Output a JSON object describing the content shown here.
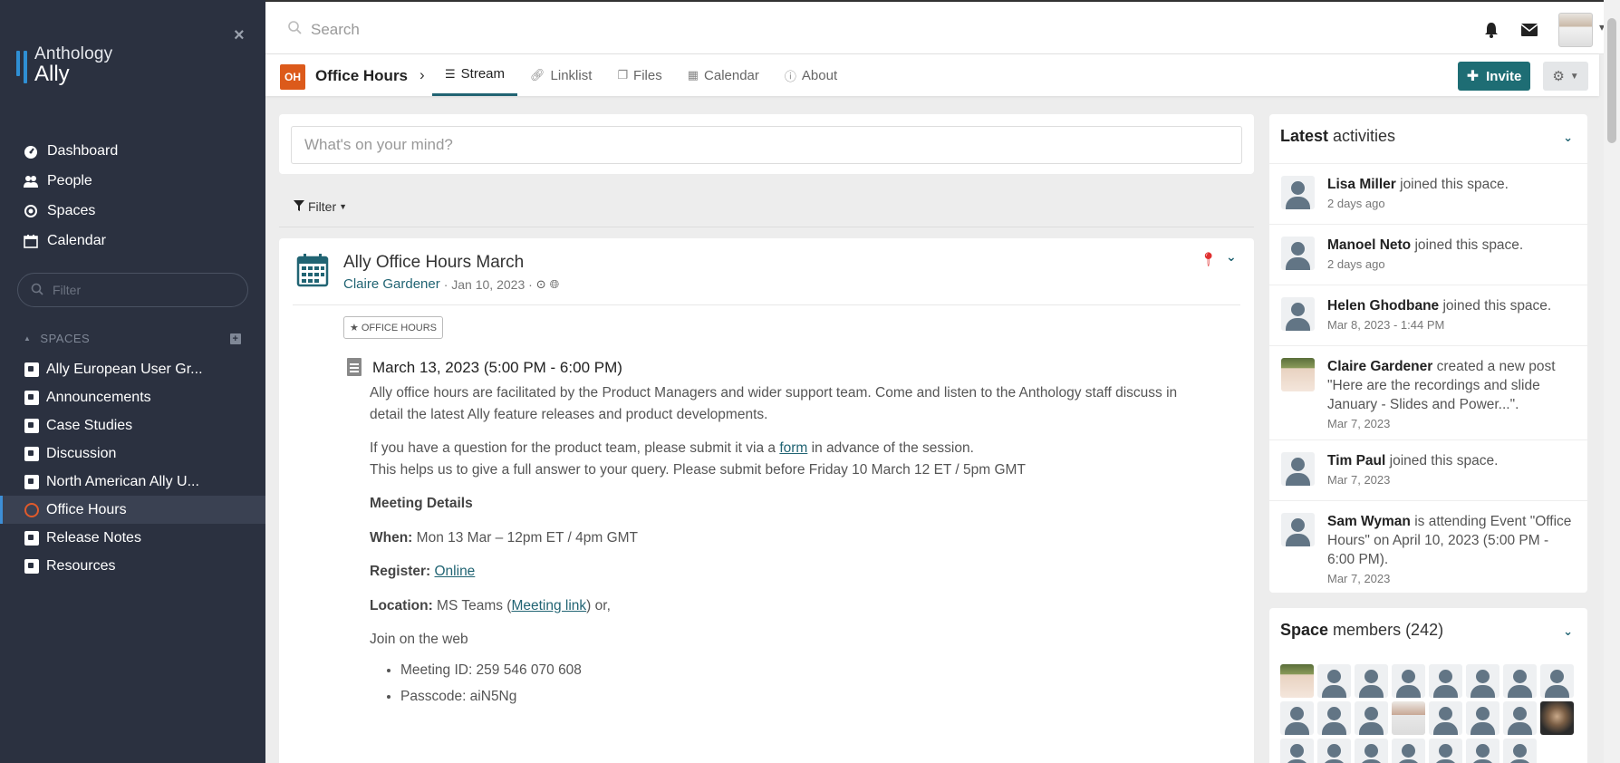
{
  "sidebar": {
    "logo_line1": "Anthology",
    "logo_line2": "Ally",
    "nav": [
      {
        "label": "Dashboard",
        "icon": "dashboard-icon"
      },
      {
        "label": "People",
        "icon": "people-icon"
      },
      {
        "label": "Spaces",
        "icon": "spaces-icon"
      },
      {
        "label": "Calendar",
        "icon": "calendar-icon"
      }
    ],
    "filter_placeholder": "Filter",
    "spaces_header": "SPACES",
    "spaces": [
      {
        "label": "Ally European User Gr..."
      },
      {
        "label": "Announcements"
      },
      {
        "label": "Case Studies"
      },
      {
        "label": "Discussion"
      },
      {
        "label": "North American Ally U..."
      },
      {
        "label": "Office Hours",
        "active": true
      },
      {
        "label": "Release Notes"
      },
      {
        "label": "Resources"
      }
    ]
  },
  "topbar": {
    "search_placeholder": "Search"
  },
  "space": {
    "badge": "OH",
    "badge_color": "#dc5a1b",
    "title": "Office Hours",
    "tabs": [
      {
        "label": "Stream",
        "icon": "list-icon",
        "active": true
      },
      {
        "label": "Linklist",
        "icon": "link-icon"
      },
      {
        "label": "Files",
        "icon": "files-icon"
      },
      {
        "label": "Calendar",
        "icon": "calendar-icon"
      },
      {
        "label": "About",
        "icon": "info-icon"
      }
    ],
    "invite_label": "Invite",
    "accent": "#1e6d74"
  },
  "composer": {
    "placeholder": "What's on your mind?"
  },
  "filter_label": "Filter",
  "post": {
    "title": "Ally Office Hours March",
    "author": "Claire Gardener",
    "date": "· Jan 10, 2023 ·",
    "tag": "OFFICE HOURS",
    "event_title": "March 13, 2023 (5:00 PM - 6:00 PM)",
    "para1": "Ally office hours are facilitated by the Product Managers and wider support team. Come and listen to the Anthology staff discuss in detail the latest Ally feature releases and product developments.",
    "para2_pre": "If you have a question for the product team, please submit it via a ",
    "para2_link": "form",
    "para2_post": " in advance of the session.",
    "para3": "This helps us to give a full answer to your query. Please submit before Friday 10 March 12 ET / 5pm GMT",
    "details_heading": "Meeting Details",
    "when_label": "When:",
    "when_value": " Mon 13 Mar – 12pm ET / 4pm GMT",
    "register_label": "Register:",
    "register_link": "Online",
    "location_label": "Location:",
    "location_pre": " MS Teams (",
    "location_link": "Meeting link",
    "location_post": ") or,",
    "join_web": "Join on the web",
    "bullets": [
      "Meeting ID: 259 546 070 608",
      "Passcode: aiN5Ng"
    ]
  },
  "activities": {
    "title_bold": "Latest",
    "title_rest": " activities",
    "items": [
      {
        "name": "Lisa Miller",
        "text": " joined this space.",
        "time": "2 days ago"
      },
      {
        "name": "Manoel Neto",
        "text": " joined this space.",
        "time": "2 days ago"
      },
      {
        "name": "Helen Ghodbane",
        "text": " joined this space.",
        "time": "Mar 8, 2023 - 1:44 PM"
      },
      {
        "name": "Claire Gardener",
        "text": " created a new post \"Here are the recordings and slide January - Slides and Power...\".",
        "time": "Mar 7, 2023",
        "photo": true
      },
      {
        "name": "Tim Paul",
        "text": " joined this space.",
        "time": "Mar 7, 2023"
      },
      {
        "name": "Sam Wyman",
        "text": " is attending Event \"Office Hours\" on April 10, 2023 (5:00 PM - 6:00 PM).",
        "time": "Mar 7, 2023"
      }
    ]
  },
  "members": {
    "title_bold": "Space",
    "title_rest": " members (242)"
  }
}
